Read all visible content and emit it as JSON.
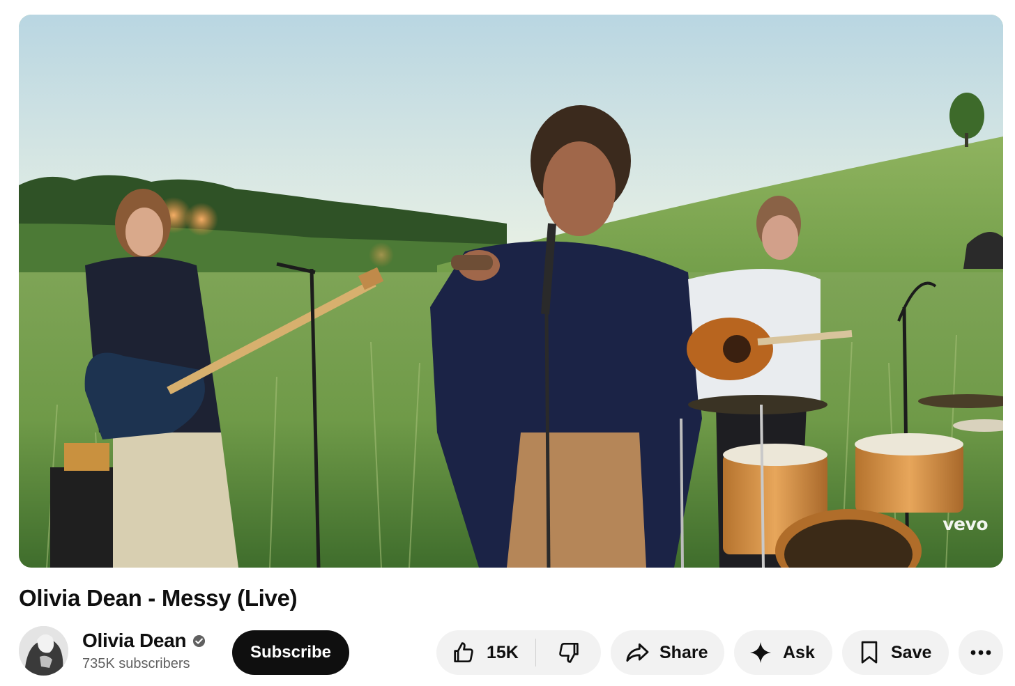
{
  "player": {
    "watermark": "vevo"
  },
  "video": {
    "title": "Olivia Dean - Messy (Live)"
  },
  "channel": {
    "name": "Olivia Dean",
    "subscribers": "735K subscribers",
    "verified": true,
    "avatar_icon": "avatar-icon"
  },
  "actions": {
    "subscribe_label": "Subscribe",
    "like_count": "15K",
    "share_label": "Share",
    "ask_label": "Ask",
    "save_label": "Save",
    "icons": {
      "like": "thumbs-up-icon",
      "dislike": "thumbs-down-icon",
      "share": "share-arrow-icon",
      "ask": "sparkle-icon",
      "save": "bookmark-icon",
      "more": "more-horizontal-icon"
    }
  },
  "colors": {
    "subscribe_bg": "#0f0f0f",
    "pill_bg": "#f2f2f2",
    "text_primary": "#0f0f0f",
    "text_secondary": "#606060"
  }
}
